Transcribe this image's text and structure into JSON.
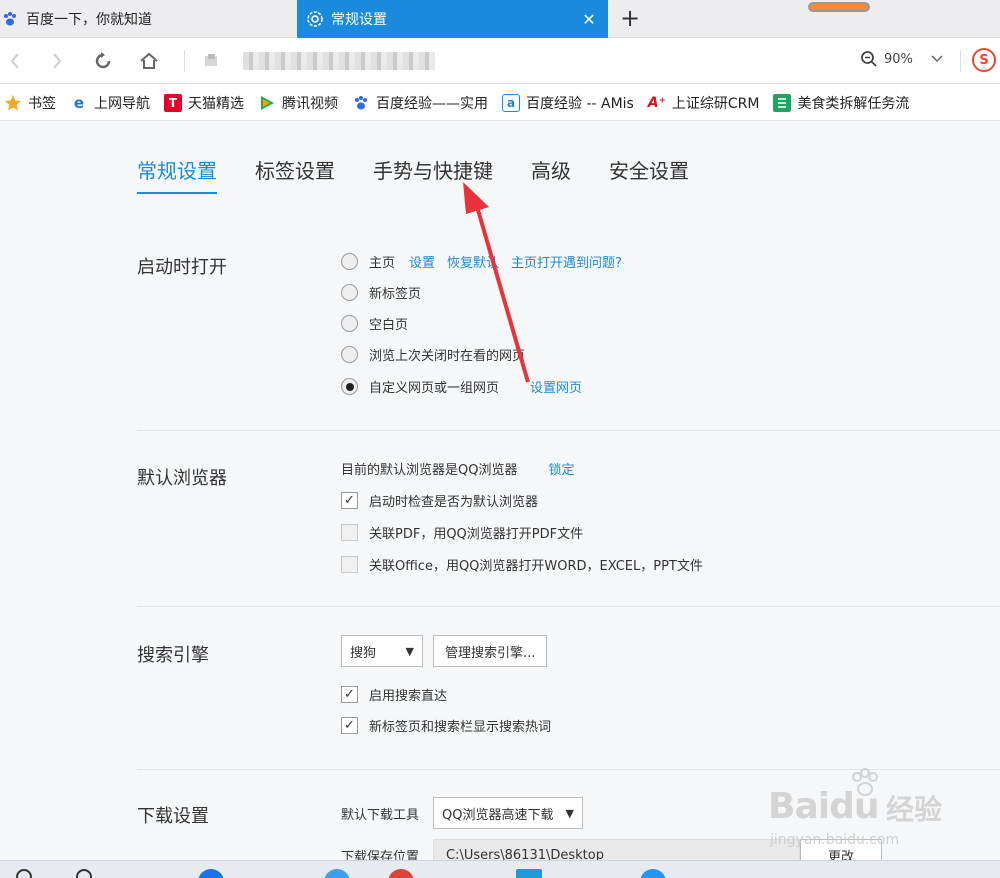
{
  "tabs": [
    {
      "title": "百度一下，你就知道"
    },
    {
      "title": "常规设置"
    }
  ],
  "toolbar": {
    "zoom": "90%",
    "new_tab": "+",
    "close": "✕"
  },
  "bookmarks": [
    {
      "label": "书签",
      "icon": "star-icon",
      "color": "#f5a623"
    },
    {
      "label": "上网导航",
      "icon": "ie-icon",
      "color": "#1a73e8"
    },
    {
      "label": "天猫精选",
      "icon": "tmall-icon",
      "color": "#e4002b"
    },
    {
      "label": "腾讯视频",
      "icon": "tencent-video-icon",
      "color": "#20b14a"
    },
    {
      "label": "百度经验——实用",
      "icon": "baidu-paw-icon",
      "color": "#2e6be6"
    },
    {
      "label": "百度经验 -- AMis",
      "icon": "amis-icon",
      "color": "#1a8bdc"
    },
    {
      "label": "上证综研CRM",
      "icon": "crm-icon",
      "color": "#d8141b"
    },
    {
      "label": "美食类拆解任务流",
      "icon": "sheet-icon",
      "color": "#21a366"
    }
  ],
  "settings_tabs": [
    {
      "label": "常规设置",
      "active": true
    },
    {
      "label": "标签设置",
      "active": false
    },
    {
      "label": "手势与快捷键",
      "active": false
    },
    {
      "label": "高级",
      "active": false
    },
    {
      "label": "安全设置",
      "active": false
    }
  ],
  "startup": {
    "title": "启动时打开",
    "options": [
      {
        "label": "主页",
        "selected": false,
        "links": [
          "设置",
          "恢复默认",
          "主页打开遇到问题?"
        ]
      },
      {
        "label": "新标签页",
        "selected": false,
        "links": []
      },
      {
        "label": "空白页",
        "selected": false,
        "links": []
      },
      {
        "label": "浏览上次关闭时在看的网页",
        "selected": false,
        "links": []
      },
      {
        "label": "自定义网页或一组网页",
        "selected": true,
        "links": [
          "设置网页"
        ]
      }
    ]
  },
  "default_browser": {
    "title": "默认浏览器",
    "status": "目前的默认浏览器是QQ浏览器",
    "lock_link": "锁定",
    "options": [
      {
        "label": "启动时检查是否为默认浏览器",
        "checked": true
      },
      {
        "label": "关联PDF，用QQ浏览器打开PDF文件",
        "checked": false
      },
      {
        "label": "关联Office，用QQ浏览器打开WORD，EXCEL，PPT文件",
        "checked": false
      }
    ]
  },
  "search": {
    "title": "搜索引擎",
    "engine": "搜狗",
    "manage_button": "管理搜索引擎...",
    "options": [
      {
        "label": "启用搜索直达",
        "checked": true
      },
      {
        "label": "新标签页和搜索栏显示搜索热词",
        "checked": true
      }
    ]
  },
  "download": {
    "title": "下载设置",
    "tool_label": "默认下载工具",
    "tool_value": "QQ浏览器高速下载",
    "path_label": "下载保存位置",
    "path_value": "C:\\Users\\86131\\Desktop",
    "change_button": "更改"
  },
  "watermark": {
    "brand": "Baidu",
    "brand_cn": "经验",
    "url": "jingyan.baidu.com"
  },
  "colors": {
    "accent": "#1a8bdc",
    "annotation_arrow": "#e8333a"
  }
}
